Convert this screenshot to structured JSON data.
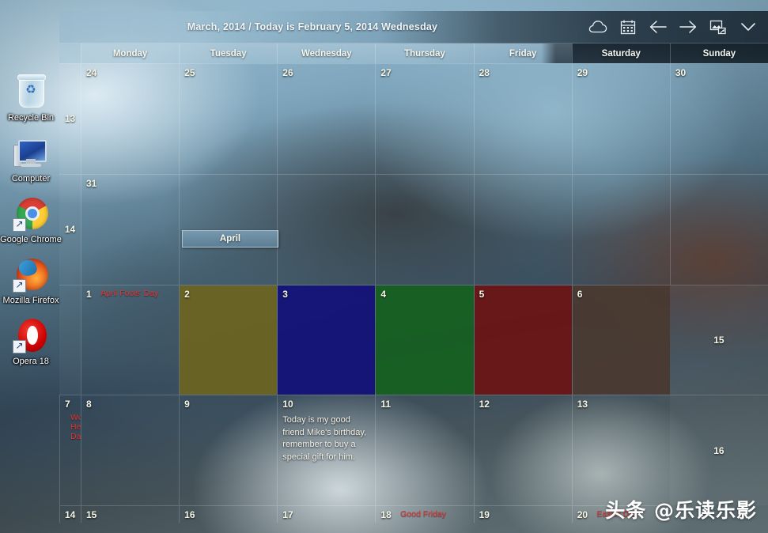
{
  "desktop": {
    "icons": [
      {
        "name": "recycle-bin",
        "label": "Recycle Bin"
      },
      {
        "name": "computer",
        "label": "Computer"
      },
      {
        "name": "google-chrome",
        "label": "Google Chrome"
      },
      {
        "name": "mozilla-firefox",
        "label": "Mozilla Firefox"
      },
      {
        "name": "opera-18",
        "label": "Opera 18"
      }
    ]
  },
  "watermark": {
    "text": "头条 @乐读乐影"
  },
  "calendar": {
    "title": "March, 2014 / Today is February 5, 2014 Wednesday",
    "current_month": "March, 2014",
    "today_text": "Today is February 5, 2014 Wednesday",
    "toolbar": [
      {
        "name": "cloud-icon",
        "label": "Cloud"
      },
      {
        "name": "calendar-icon",
        "label": "Calendar"
      },
      {
        "name": "arrow-left-icon",
        "label": "Previous"
      },
      {
        "name": "arrow-right-icon",
        "label": "Next"
      },
      {
        "name": "wallpaper-icon",
        "label": "Set as wallpaper"
      },
      {
        "name": "chevron-down-icon",
        "label": "More"
      }
    ],
    "weekdays": [
      {
        "label": "Monday",
        "weekend": false
      },
      {
        "label": "Tuesday",
        "weekend": false
      },
      {
        "label": "Wednesday",
        "weekend": false
      },
      {
        "label": "Thursday",
        "weekend": false
      },
      {
        "label": "Friday",
        "weekend": false
      },
      {
        "label": "Saturday",
        "weekend": true
      },
      {
        "label": "Sunday",
        "weekend": true
      }
    ],
    "month_tooltip": "April",
    "weeks": [
      {
        "week_number": "13",
        "days": [
          {
            "num": "24",
            "holiday": "",
            "note": "",
            "tint": ""
          },
          {
            "num": "25",
            "holiday": "",
            "note": "",
            "tint": ""
          },
          {
            "num": "26",
            "holiday": "",
            "note": "",
            "tint": ""
          },
          {
            "num": "27",
            "holiday": "",
            "note": "",
            "tint": ""
          },
          {
            "num": "28",
            "holiday": "",
            "note": "",
            "tint": ""
          },
          {
            "num": "29",
            "holiday": "",
            "note": "",
            "tint": ""
          },
          {
            "num": "30",
            "holiday": "",
            "note": "",
            "tint": ""
          }
        ]
      },
      {
        "week_number": "14",
        "days": [
          {
            "num": "31",
            "holiday": "",
            "note": "",
            "tint": ""
          },
          {
            "num": "",
            "holiday": "",
            "note": "",
            "tint": ""
          },
          {
            "num": "",
            "holiday": "",
            "note": "",
            "tint": ""
          },
          {
            "num": "",
            "holiday": "",
            "note": "",
            "tint": ""
          },
          {
            "num": "",
            "holiday": "",
            "note": "",
            "tint": ""
          },
          {
            "num": "",
            "holiday": "",
            "note": "",
            "tint": ""
          },
          {
            "num": "",
            "holiday": "",
            "note": "",
            "tint": ""
          }
        ]
      },
      {
        "week_number": "",
        "days": [
          {
            "num": "1",
            "holiday": "April Fools' Day",
            "note": "",
            "tint": ""
          },
          {
            "num": "2",
            "holiday": "",
            "note": "",
            "tint": "#6d6420"
          },
          {
            "num": "3",
            "holiday": "",
            "note": "",
            "tint": "#12107a"
          },
          {
            "num": "4",
            "holiday": "",
            "note": "",
            "tint": "#16611f"
          },
          {
            "num": "5",
            "holiday": "",
            "note": "",
            "tint": "#6d1414"
          },
          {
            "num": "6",
            "holiday": "",
            "note": "",
            "tint": "#4a3a30"
          }
        ]
      },
      {
        "week_number": "15",
        "days": [
          {
            "num": "7",
            "holiday": "World Health Day",
            "note": "",
            "tint": ""
          },
          {
            "num": "8",
            "holiday": "",
            "note": "",
            "tint": ""
          },
          {
            "num": "9",
            "holiday": "",
            "note": "",
            "tint": ""
          },
          {
            "num": "10",
            "holiday": "",
            "note": "Today is my good friend Mike's birthday, remember to buy a special gift for him.",
            "tint": ""
          },
          {
            "num": "11",
            "holiday": "",
            "note": "",
            "tint": ""
          },
          {
            "num": "12",
            "holiday": "",
            "note": "",
            "tint": ""
          },
          {
            "num": "13",
            "holiday": "",
            "note": "",
            "tint": ""
          }
        ]
      },
      {
        "week_number": "16",
        "days": [
          {
            "num": "14",
            "holiday": "",
            "note": "",
            "tint": ""
          },
          {
            "num": "15",
            "holiday": "",
            "note": "",
            "tint": ""
          },
          {
            "num": "16",
            "holiday": "",
            "note": "",
            "tint": ""
          },
          {
            "num": "17",
            "holiday": "",
            "note": "",
            "tint": ""
          },
          {
            "num": "18",
            "holiday": "Good Friday",
            "note": "",
            "tint": ""
          },
          {
            "num": "19",
            "holiday": "",
            "note": "",
            "tint": ""
          },
          {
            "num": "20",
            "holiday": "Easter Day",
            "note": "",
            "tint": ""
          }
        ]
      }
    ],
    "colors": {
      "holiday_text": "#e8322e",
      "day_number": "#f7f7e6",
      "weekend_header_bg": "#0a121a"
    }
  }
}
